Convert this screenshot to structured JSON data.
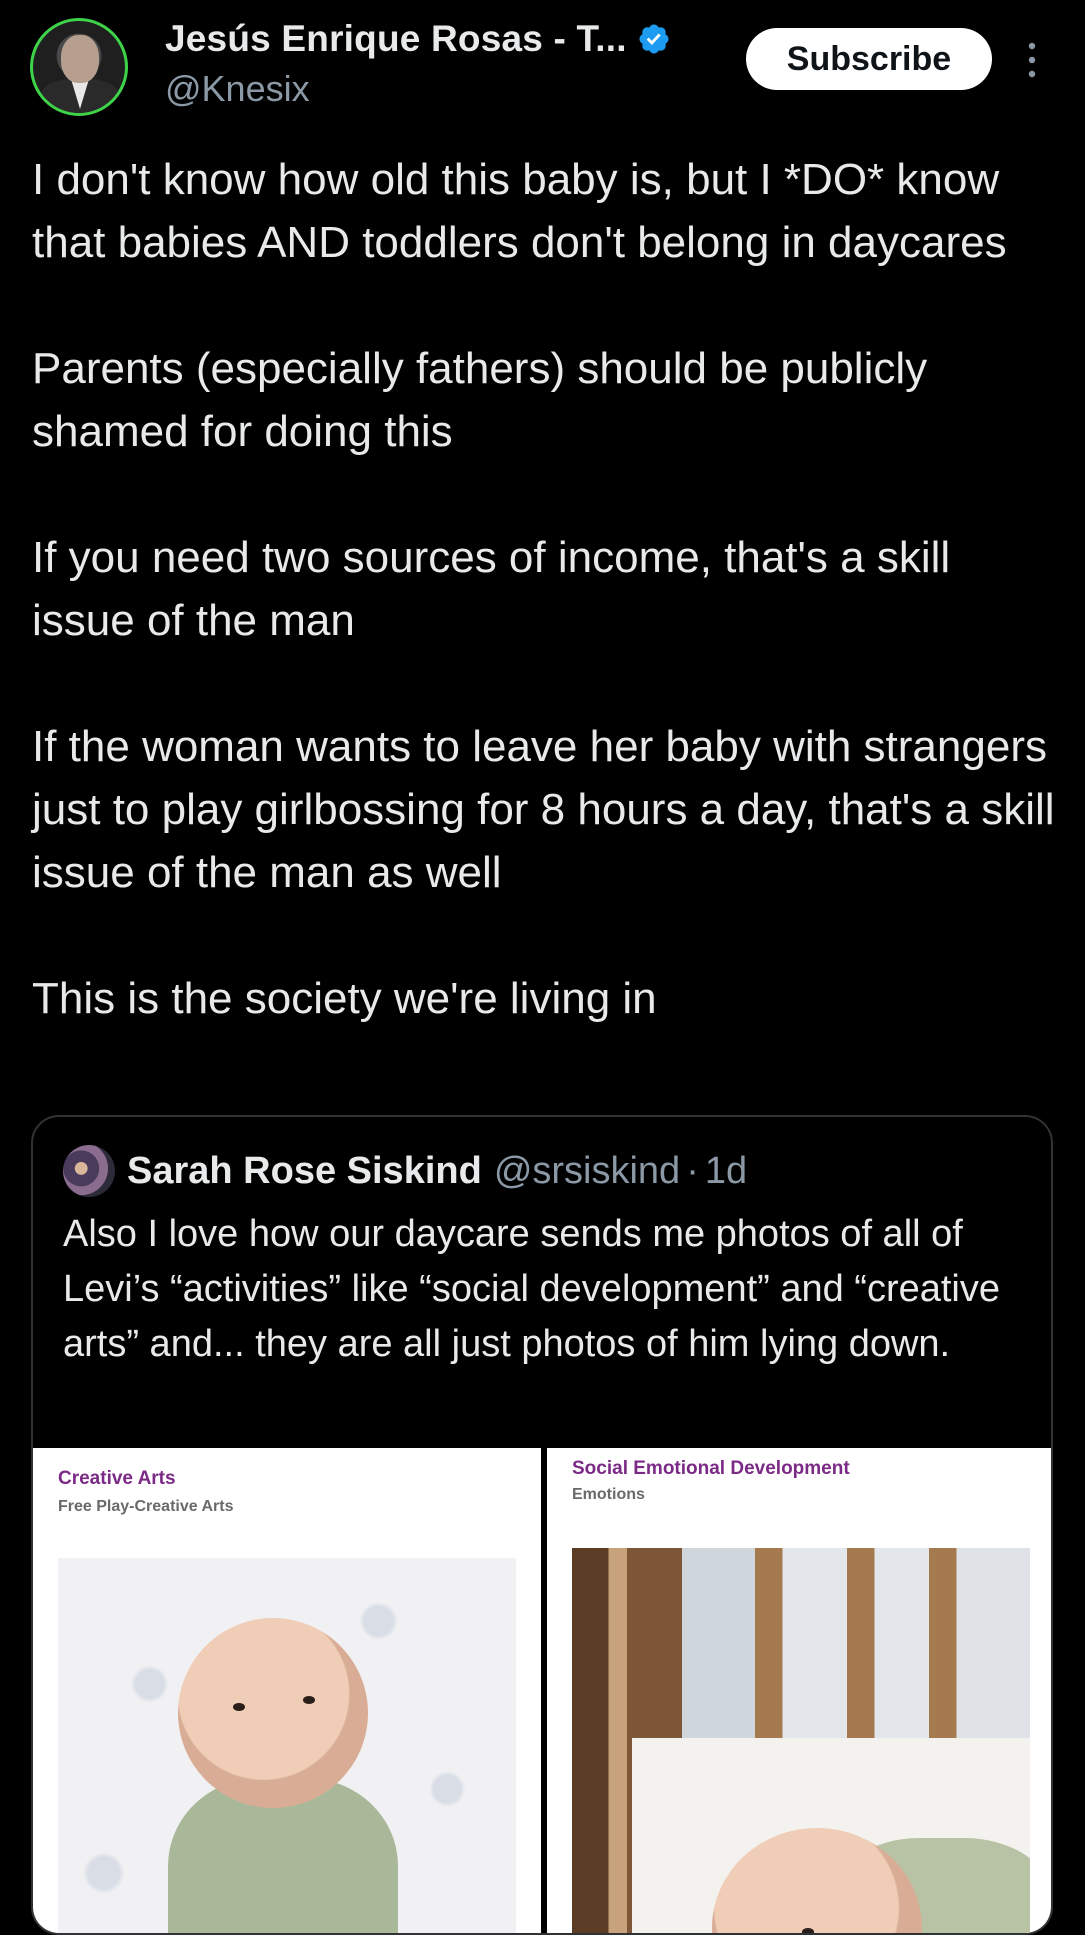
{
  "author": {
    "display_name": "Jesús Enrique Rosas - T...",
    "handle": "@Knesix",
    "verified": true,
    "avatar_icon": "profile-photo"
  },
  "actions": {
    "subscribe_label": "Subscribe",
    "more_icon": "more-vertical-icon"
  },
  "post": {
    "paragraphs": [
      "I don't know how old this baby is, but I *DO* know that babies AND toddlers don't belong in daycares",
      "Parents (especially fathers) should be publicly shamed for doing this",
      "If you need two sources of income, that's a skill issue of the man",
      "If the woman wants to leave her baby with strangers just to play girlbossing for 8 hours a day, that's a skill issue of the man as well",
      "This is the society we're living in"
    ]
  },
  "quote": {
    "display_name": "Sarah Rose Siskind",
    "handle": "@srsiskind",
    "separator": "·",
    "time": "1d",
    "text": "Also I love how our daycare sends me photos of all of Levi’s “activities” like “social development” and “creative arts” and... they are all just photos of him lying down.",
    "media": [
      {
        "title": "Creative Arts",
        "subtitle": "Free Play-Creative Arts"
      },
      {
        "title": "Social Emotional Development",
        "subtitle": "Emotions"
      }
    ]
  },
  "colors": {
    "background": "#000000",
    "text": "#e7e9ea",
    "secondary_text": "#8b98a5",
    "verified_badge": "#1d9bf0",
    "avatar_ring": "#3fd34a",
    "media_title": "#7b2a86"
  }
}
